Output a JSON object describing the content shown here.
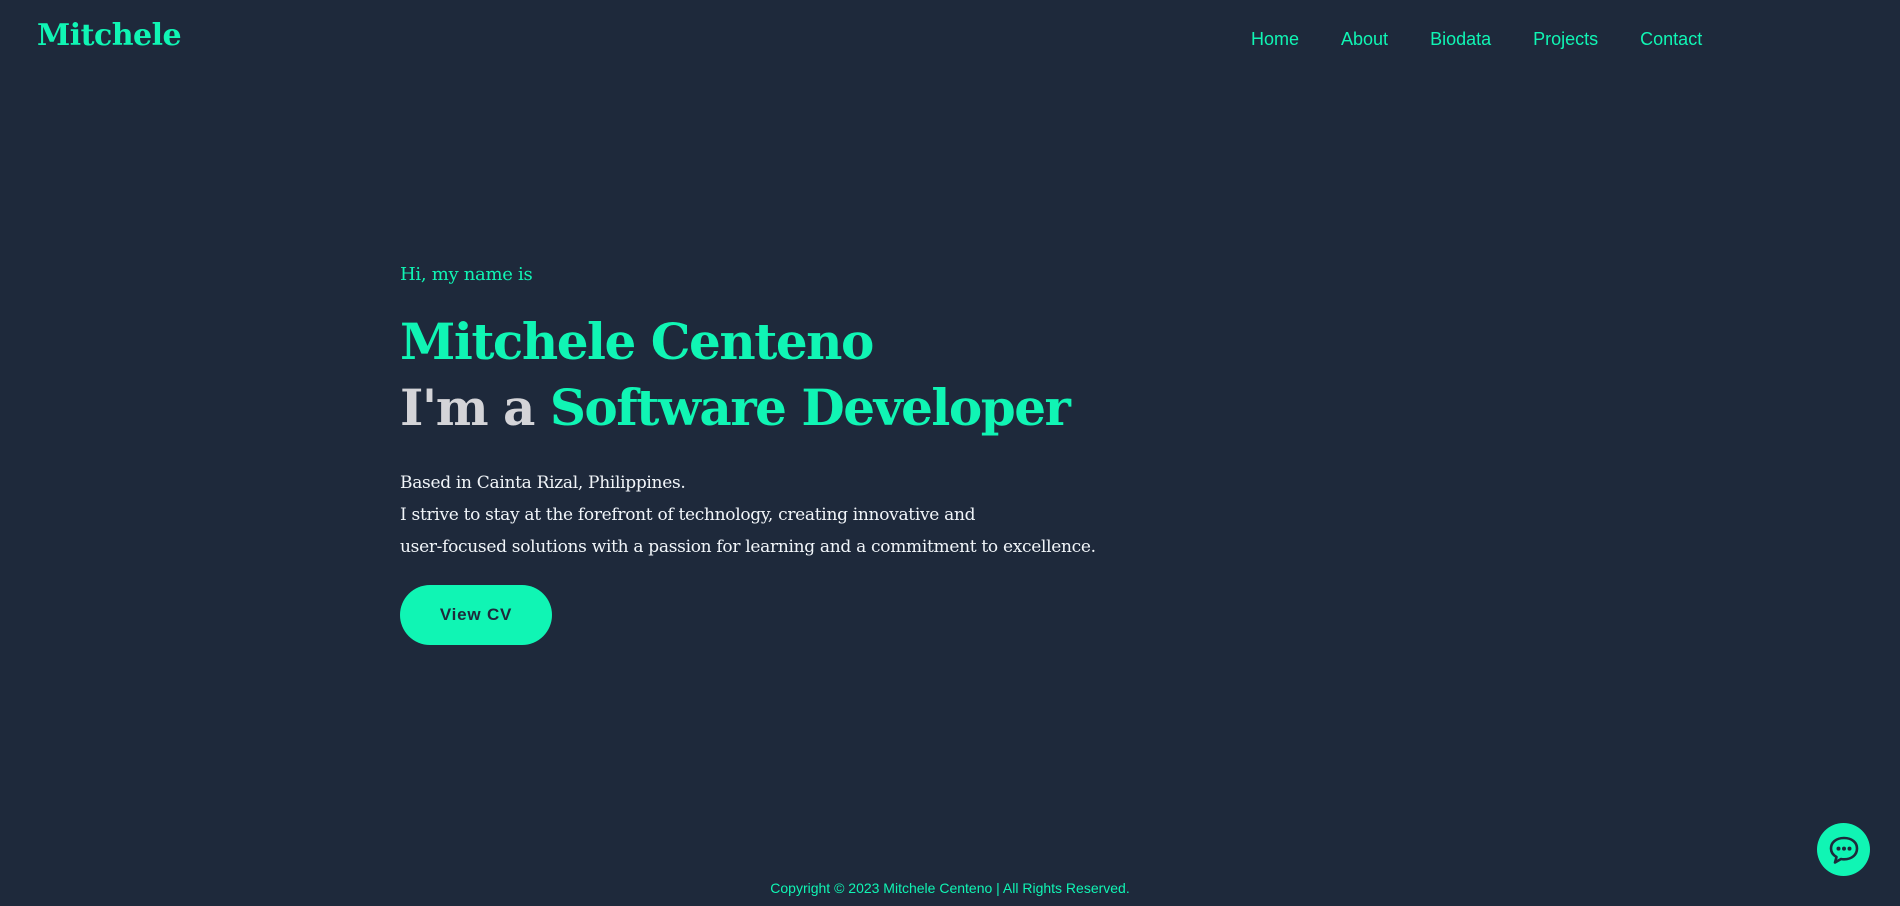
{
  "brand": {
    "logo": "Mitchele"
  },
  "nav": {
    "items": [
      {
        "label": "Home"
      },
      {
        "label": "About"
      },
      {
        "label": "Biodata"
      },
      {
        "label": "Projects"
      },
      {
        "label": "Contact"
      }
    ]
  },
  "hero": {
    "greeting": "Hi, my name is",
    "name": "Mitchele Centeno",
    "role_prefix": "I'm a",
    "role_title": "Software Developer",
    "bio_lines": [
      "Based in Cainta Rizal, Philippines.",
      "I strive to stay at the forefront of technology, creating innovative and",
      "user-focused solutions with a passion for learning and a commitment to excellence."
    ],
    "cta_label": "View CV"
  },
  "footer": {
    "copyright": "Copyright © 2023 Mitchele Centeno | All Rights Reserved."
  },
  "icons": {
    "chat_button": "chat-bubble-icon"
  },
  "colors": {
    "background": "#1e293b",
    "accent": "#10f5b4",
    "muted_text": "#d4d4d8"
  }
}
